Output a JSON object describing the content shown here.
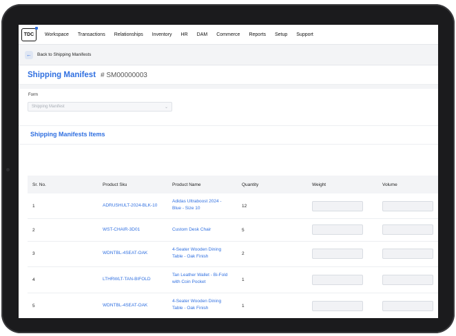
{
  "nav": {
    "logo_text": "TDC",
    "items": [
      "Workspace",
      "Transactions",
      "Relationships",
      "Inventory",
      "HR",
      "DAM",
      "Commerce",
      "Reports",
      "Setup",
      "Support"
    ]
  },
  "back": {
    "label": "Back to Shipping Manifests"
  },
  "header": {
    "title": "Shipping Manifest",
    "id": "# SM00000003"
  },
  "form": {
    "label": "Form",
    "value": "Shipping Manifest"
  },
  "section": {
    "title": "Shipping Manifests Items"
  },
  "table": {
    "columns": [
      "Sr. No.",
      "Product Sku",
      "Product Name",
      "Quantity",
      "Weight",
      "Volume"
    ],
    "rows": [
      {
        "sr": "1",
        "sku": "ADRUSHULT-2024-BLK-10",
        "name_l1": "Adidas Ultraboost 2024 -",
        "name_l2": "Blue - Size 10",
        "qty": "12"
      },
      {
        "sr": "2",
        "sku": "WST-CHAIR-3D01",
        "name_l1": "Custom Desk Chair",
        "name_l2": "",
        "qty": "5"
      },
      {
        "sr": "3",
        "sku": "WDNTBL-4SEAT-OAK",
        "name_l1": "4-Seater Wooden Dining",
        "name_l2": "Table - Oak Finish",
        "qty": "2"
      },
      {
        "sr": "4",
        "sku": "LTHRWLT-TAN-BIFOLD",
        "name_l1": "Tan Leather Wallet - Bi-Fold",
        "name_l2": "with Coin Pocket",
        "qty": "1"
      },
      {
        "sr": "5",
        "sku": "WDNTBL-4SEAT-OAK",
        "name_l1": "4-Seater Wooden Dining",
        "name_l2": "Table - Oak Finish",
        "qty": "1"
      }
    ]
  },
  "colors": {
    "accent": "#2f6fe0",
    "device": "#1b1b1d",
    "bar": "#f3f4f6"
  }
}
